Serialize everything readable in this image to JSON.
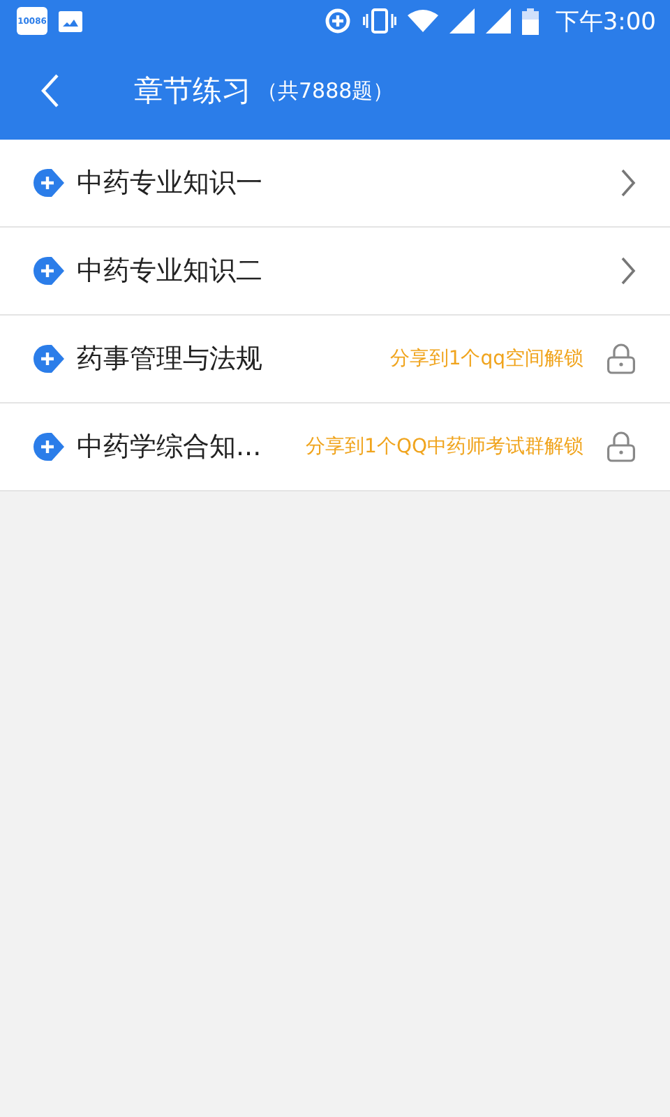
{
  "status_bar": {
    "app_badge": "10086",
    "time": "下午3:00"
  },
  "toolbar": {
    "title": "章节练习",
    "count": "（共7888题）"
  },
  "chapters": [
    {
      "title": "中药专业知识一",
      "kind": "open"
    },
    {
      "title": "中药专业知识二",
      "kind": "open"
    },
    {
      "title": "药事管理与法规",
      "kind": "locked",
      "hint": "分享到1个qq空间解锁"
    },
    {
      "title": "中药学综合知...",
      "kind": "locked",
      "hint": "分享到1个QQ中药师考试群解锁"
    }
  ]
}
